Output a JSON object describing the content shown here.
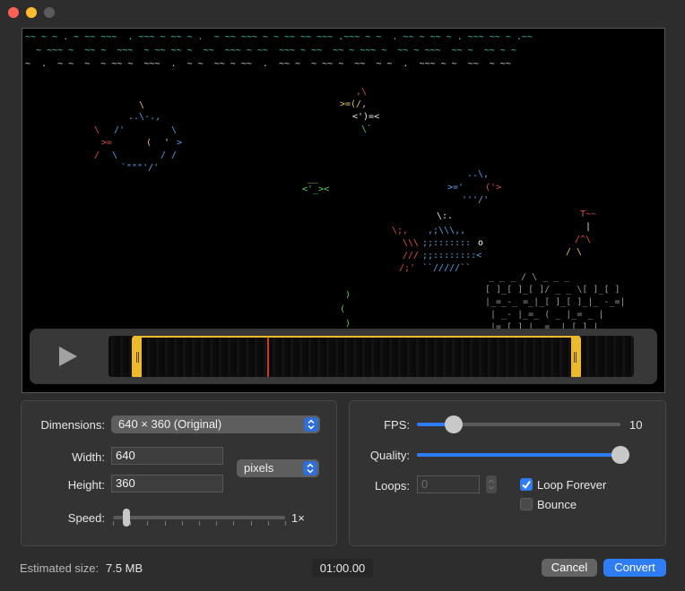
{
  "window": {
    "traffic_lights": [
      "close",
      "minimize",
      "zoom"
    ]
  },
  "preview": {
    "water_rows": [
      "~~ ~ ~ . ~ ~~ ~~~  . ~~~ ~ ~~ ~ .  ~ ~~ ~~~ ~ ~ ~~ ~~ ~~~ .~~~ ~ ~  . ~~ ~ ~~ ~ . ~~~ ~~ ~ .~~",
      "  ~ ~~~ ~  ~~ ~  ~~~  ~ ~~ ~~ ~  ~~  ~~~ ~ ~~  ~~~ ~ ~~  ~~ ~ ~~~ ~  ~~ ~ ~~~  ~~ ~  ~~ ~ ~",
      "~  .  ~ ~  ~  ~ ~~ ~  ~~~  .  ~ ~  ~~ ~ ~~  .  ~~ ~  ~ ~~ ~  ~~  ~ ~  .  ~~~ ~ ~  ~~  ~ ~~"
    ]
  },
  "player": {
    "play_icon": "play-icon",
    "trim_handle_icon": "trim-handle-icon",
    "playhead_color": "#d23a2a",
    "trim_color": "#f5c12e"
  },
  "settings": {
    "dimensions_label": "Dimensions:",
    "dimensions_value": "640 × 360 (Original)",
    "width_label": "Width:",
    "width_value": "640",
    "height_label": "Height:",
    "height_value": "360",
    "units_value": "pixels",
    "speed_label": "Speed:",
    "speed_value": "1×",
    "speed_position": 0.08
  },
  "output": {
    "fps_label": "FPS:",
    "fps_value": "10",
    "fps_position": 0.18,
    "quality_label": "Quality:",
    "quality_position": 1.0,
    "loops_label": "Loops:",
    "loops_placeholder": "0",
    "loop_forever_label": "Loop Forever",
    "loop_forever_checked": true,
    "bounce_label": "Bounce",
    "bounce_checked": false
  },
  "footer": {
    "estimated_label": "Estimated size:",
    "estimated_value": "7.5 MB",
    "duration": "01:00.00",
    "cancel_label": "Cancel",
    "convert_label": "Convert"
  },
  "colors": {
    "accent": "#2e7cf6",
    "trim": "#f5c12e"
  }
}
